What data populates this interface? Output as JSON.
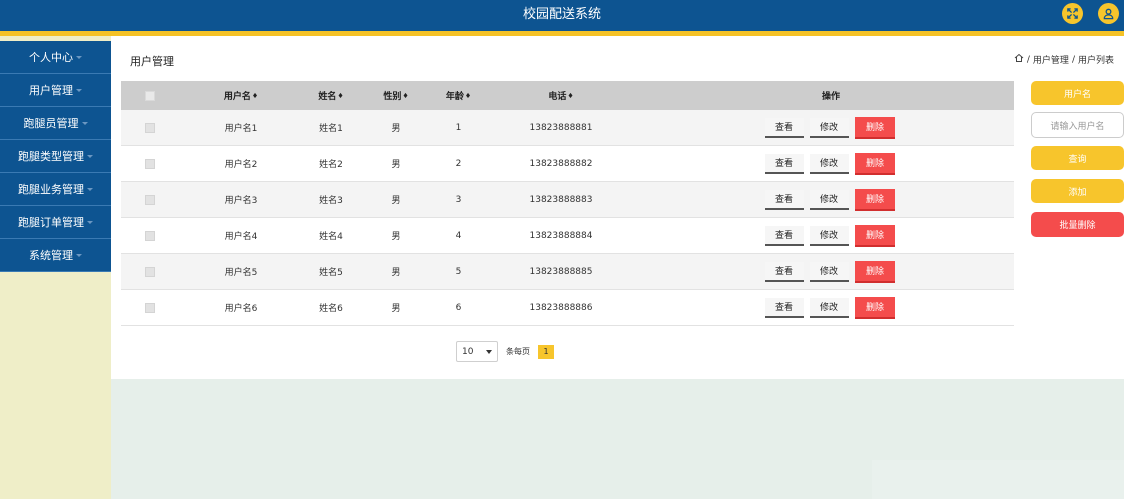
{
  "app": {
    "title": "校园配送系统"
  },
  "topbar_icons": [
    "fullscreen-icon",
    "user-icon"
  ],
  "sidebar": {
    "items": [
      {
        "label": "个人中心"
      },
      {
        "label": "用户管理"
      },
      {
        "label": "跑腿员管理"
      },
      {
        "label": "跑腿类型管理"
      },
      {
        "label": "跑腿业务管理"
      },
      {
        "label": "跑腿订单管理"
      },
      {
        "label": "系统管理"
      }
    ]
  },
  "main": {
    "page_title": "用户管理",
    "breadcrumb": {
      "separator": "/",
      "items": [
        "用户管理",
        "用户列表"
      ]
    }
  },
  "table": {
    "columns": {
      "username": "用户名",
      "name": "姓名",
      "gender": "性别",
      "age": "年龄",
      "phone": "电话",
      "actions": "操作"
    },
    "sort_glyph": "♦",
    "rows": [
      {
        "username": "用户名1",
        "name": "姓名1",
        "gender": "男",
        "age": "1",
        "phone": "13823888881"
      },
      {
        "username": "用户名2",
        "name": "姓名2",
        "gender": "男",
        "age": "2",
        "phone": "13823888882"
      },
      {
        "username": "用户名3",
        "name": "姓名3",
        "gender": "男",
        "age": "3",
        "phone": "13823888883"
      },
      {
        "username": "用户名4",
        "name": "姓名4",
        "gender": "男",
        "age": "4",
        "phone": "13823888884"
      },
      {
        "username": "用户名5",
        "name": "姓名5",
        "gender": "男",
        "age": "5",
        "phone": "13823888885"
      },
      {
        "username": "用户名6",
        "name": "姓名6",
        "gender": "男",
        "age": "6",
        "phone": "13823888886"
      }
    ],
    "actions": {
      "view": "查看",
      "edit": "修改",
      "delete": "删除"
    }
  },
  "pagination": {
    "page_size": "10",
    "per_page_label": "条每页",
    "current_page": "1"
  },
  "search_panel": {
    "field_label": "用户名",
    "input_placeholder": "请输入用户名",
    "search_label": "查询",
    "add_label": "添加",
    "batch_delete_label": "批量删除"
  },
  "colors": {
    "header_blue": "#0d5491",
    "accent_yellow": "#f7c52c",
    "danger_red": "#f44c4c",
    "sidebar_bg": "#efeec8",
    "page_bg": "#e6efea"
  }
}
